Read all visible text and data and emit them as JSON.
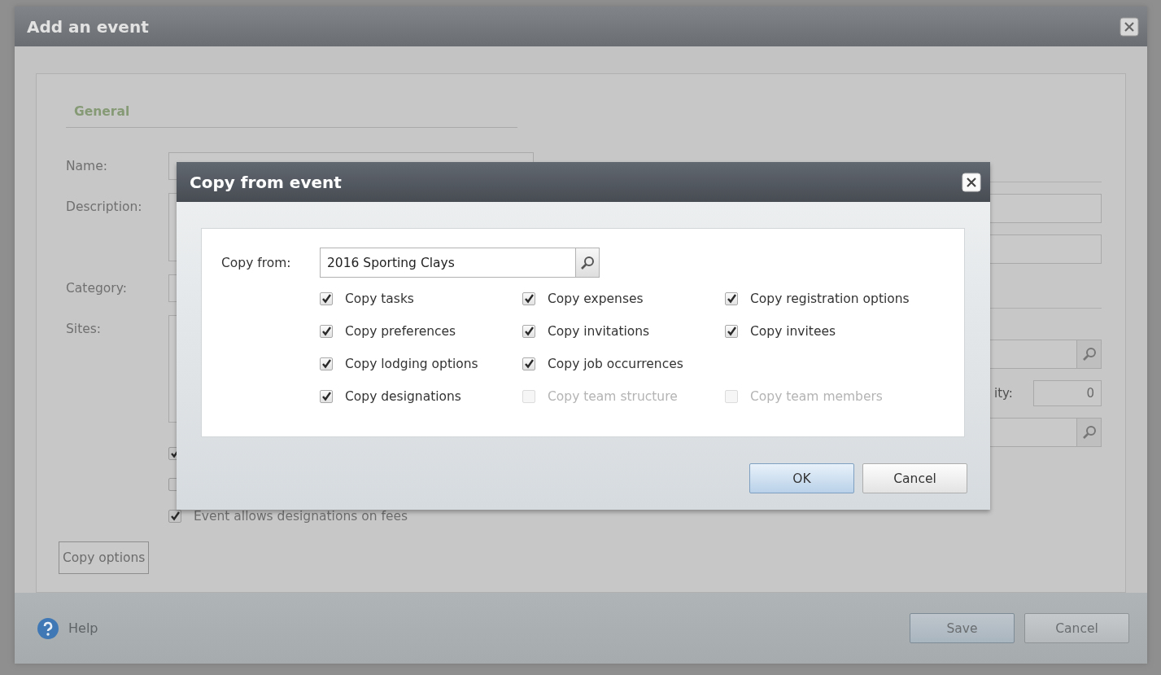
{
  "main_dialog": {
    "title": "Add an event",
    "section": "General",
    "fields": [
      {
        "label": "Name:",
        "kind": "text"
      },
      {
        "label": "Description:",
        "kind": "multiline"
      },
      {
        "label": "Category:",
        "kind": "text"
      },
      {
        "label": "Sites:",
        "kind": "list"
      }
    ],
    "options": [
      {
        "checked": true
      },
      {
        "checked": false
      },
      {
        "label": "Event allows designations on fees",
        "checked": true
      }
    ],
    "right_fields": [
      {
        "kind": "text"
      },
      {
        "kind": "text"
      },
      {
        "kind": "lookup"
      },
      {
        "kind": "numeric",
        "label": "ity:",
        "value": "0"
      },
      {
        "kind": "lookup"
      }
    ],
    "copy_options_button": "Copy options",
    "help": "Help",
    "buttons": [
      {
        "label": "Save",
        "default": true
      },
      {
        "label": "Cancel",
        "default": false
      }
    ]
  },
  "copy_dialog": {
    "title": "Copy from event",
    "copy_from": {
      "label": "Copy from:",
      "value": "2016 Sporting Clays"
    },
    "option_rows": [
      [
        {
          "label": "Copy tasks",
          "checked": true,
          "disabled": false
        },
        {
          "label": "Copy expenses",
          "checked": true,
          "disabled": false
        },
        {
          "label": "Copy registration options",
          "checked": true,
          "disabled": false
        }
      ],
      [
        {
          "label": "Copy preferences",
          "checked": true,
          "disabled": false
        },
        {
          "label": "Copy invitations",
          "checked": true,
          "disabled": false
        },
        {
          "label": "Copy invitees",
          "checked": true,
          "disabled": false
        }
      ],
      [
        {
          "label": "Copy lodging options",
          "checked": true,
          "disabled": false
        },
        {
          "label": "Copy job occurrences",
          "checked": true,
          "disabled": false
        }
      ],
      [
        {
          "label": "Copy designations",
          "checked": true,
          "disabled": false
        },
        {
          "label": "Copy team structure",
          "checked": false,
          "disabled": true
        },
        {
          "label": "Copy team members",
          "checked": false,
          "disabled": true
        }
      ]
    ],
    "buttons": [
      {
        "label": "OK",
        "default": true
      },
      {
        "label": "Cancel",
        "default": false
      }
    ]
  }
}
